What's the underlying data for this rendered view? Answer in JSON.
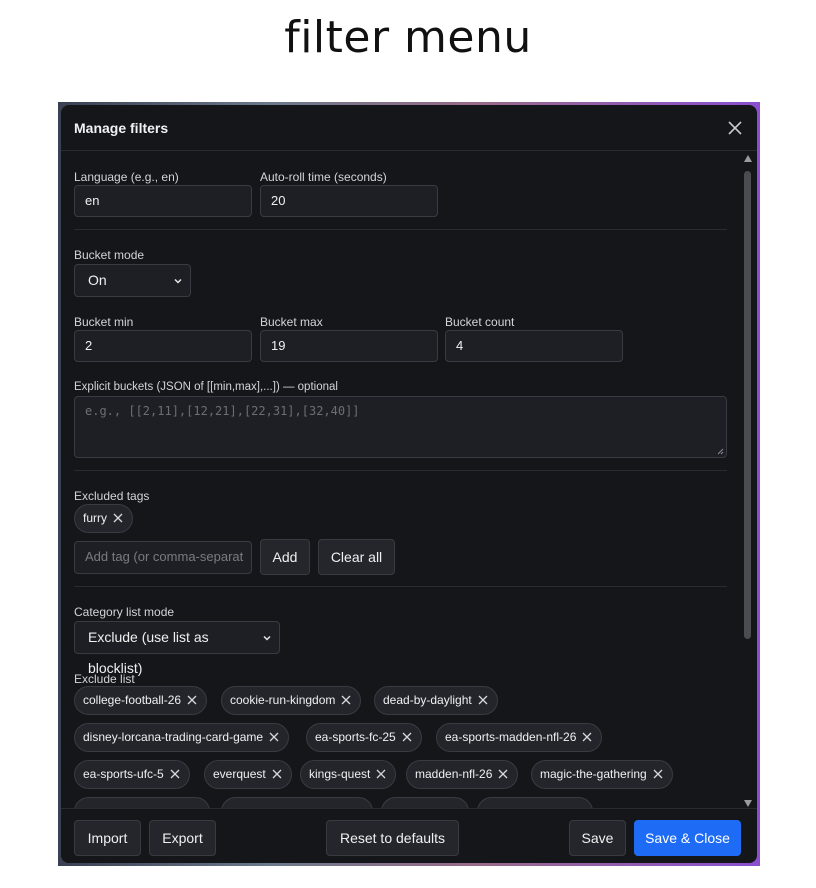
{
  "page": {
    "heading": "filter menu"
  },
  "dialog": {
    "title": "Manage filters"
  },
  "language": {
    "label": "Language (e.g., en)",
    "value": "en"
  },
  "autoroll": {
    "label": "Auto-roll time (seconds)",
    "value": "20"
  },
  "bucket_mode": {
    "label": "Bucket mode",
    "value": "On"
  },
  "bucket_min": {
    "label": "Bucket min",
    "value": "2"
  },
  "bucket_max": {
    "label": "Bucket max",
    "value": "19"
  },
  "bucket_count": {
    "label": "Bucket count",
    "value": "4"
  },
  "explicit": {
    "label": "Explicit buckets (JSON of [[min,max],...]) — optional",
    "placeholder": "e.g., [[2,11],[12,21],[22,31],[32,40]]"
  },
  "excluded_tags": {
    "label": "Excluded tags",
    "tags": [
      "furry"
    ],
    "input_placeholder": "Add tag (or comma-separat",
    "add_label": "Add",
    "clear_label": "Clear all"
  },
  "category": {
    "label": "Category list mode",
    "value": "Exclude (use list as blocklist)",
    "list_label": "Exclude list",
    "items": [
      "college-football-26",
      "cookie-run-kingdom",
      "dead-by-daylight",
      "disney-lorcana-trading-card-game",
      "ea-sports-fc-25",
      "ea-sports-madden-nfl-26",
      "ea-sports-ufc-5",
      "everquest",
      "kings-quest",
      "madden-nfl-26",
      "magic-the-gathering"
    ]
  },
  "footer": {
    "import_label": "Import",
    "export_label": "Export",
    "reset_label": "Reset to defaults",
    "save_label": "Save",
    "save_close_label": "Save & Close"
  },
  "colors": {
    "primary": "#1e6cf5",
    "dialog_bg": "#15161a",
    "field_bg": "#1e1f24"
  }
}
